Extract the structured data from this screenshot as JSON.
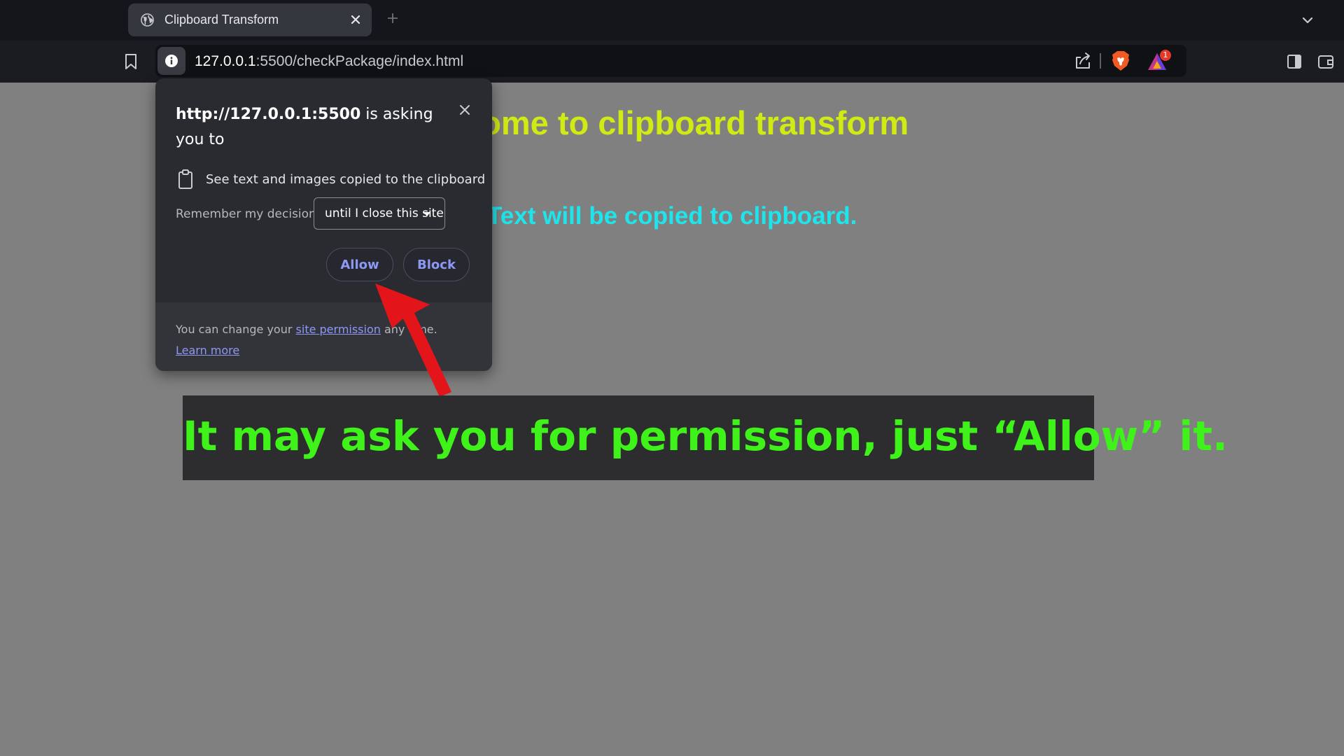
{
  "tab": {
    "title": "Clipboard Transform",
    "favicon": "globe-icon"
  },
  "address_bar": {
    "url_host": "127.0.0.1",
    "url_rest": ":5500/checkPackage/index.html"
  },
  "toolbar": {
    "rewards_badge_count": "1"
  },
  "page": {
    "heading": "come to clipboard transform",
    "subtext": "Text will be copied to clipboard."
  },
  "permission_popup": {
    "origin": "http://127.0.0.1:5500",
    "title_suffix": " is asking you to",
    "permission_text": "See text and images copied to the clipboard",
    "remember_label": "Remember my decision",
    "remember_value": "until I close this site",
    "allow_label": "Allow",
    "block_label": "Block",
    "footer_prefix": "You can change your ",
    "footer_link": "site permission",
    "footer_suffix": " any time.",
    "learn_more": "Learn more"
  },
  "annotation": {
    "caption": "It may ask you for permission, just “Allow” it.",
    "caption_color": "#3ef21a",
    "arrow_color": "#e3151a"
  },
  "colors": {
    "page_background": "#808080",
    "heading": "#d0ea14",
    "subtext": "#1ee4ec",
    "link": "#8d98f4"
  }
}
